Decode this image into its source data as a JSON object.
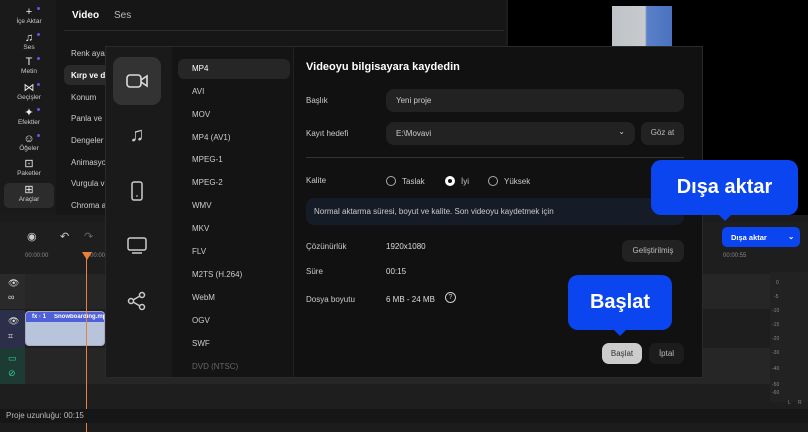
{
  "toolbar": {
    "items": [
      {
        "label": "İçe Aktar",
        "icon": "plus-icon"
      },
      {
        "label": "Ses",
        "icon": "music-icon"
      },
      {
        "label": "Metin",
        "icon": "text-icon"
      },
      {
        "label": "Geçişler",
        "icon": "transition-icon"
      },
      {
        "label": "Efektler",
        "icon": "effects-icon"
      },
      {
        "label": "Öğeler",
        "icon": "smiley-icon"
      },
      {
        "label": "Paketler",
        "icon": "package-icon"
      },
      {
        "label": "Araçlar",
        "icon": "tools-icon"
      }
    ]
  },
  "panel": {
    "tabs": [
      "Video",
      "Ses"
    ],
    "items": [
      "Renk ayar",
      "Kırp ve d",
      "Konum",
      "Panla ve",
      "Dengeler",
      "Animasyo",
      "Vurgula v",
      "Chroma a"
    ]
  },
  "timeline": {
    "time_start": "00:00:00",
    "time_mid": "00:00",
    "time_end": "00:00:55",
    "clip_fx": "fx · 1",
    "clip_name": "Snowboarding.mp4",
    "meter_labels": [
      "0",
      "-5",
      "-10",
      "-15",
      "-20",
      "-30",
      "-40",
      "-50",
      "-60"
    ],
    "lr": [
      "L",
      "R"
    ]
  },
  "export_button": {
    "label": "Dışa aktar"
  },
  "status": {
    "project_length": "Proje uzunluğu: 00:15"
  },
  "modal": {
    "title": "Videoyu bilgisayara kaydedin",
    "formats": [
      "MP4",
      "AVI",
      "MOV",
      "MP4 (AV1)",
      "MPEG-1",
      "MPEG-2",
      "WMV",
      "MKV",
      "FLV",
      "M2TS (H.264)",
      "WebM",
      "OGV",
      "SWF",
      "DVD (NTSC)"
    ],
    "title_label": "Başlık",
    "title_value": "Yeni proje",
    "dest_label": "Kayıt hedefi",
    "dest_value": "E:\\Movavi",
    "browse": "Göz at",
    "quality_label": "Kalite",
    "quality_options": [
      "Taslak",
      "İyi",
      "Yüksek"
    ],
    "quality_selected": "İyi",
    "quality_info": "Normal aktarma süresi, boyut ve kalite. Son videoyu kaydetmek için",
    "resolution_label": "Çözünürlük",
    "resolution": "1920x1080",
    "duration_label": "Süre",
    "duration": "00:15",
    "size_label": "Dosya boyutu",
    "size": "6 MB - 24 MB",
    "advanced": "Geliştirilmiş",
    "start": "Başlat",
    "cancel": "İptal"
  },
  "callouts": {
    "export": "Dışa aktar",
    "start": "Başlat"
  },
  "colors": {
    "accent": "#0a45ef"
  }
}
